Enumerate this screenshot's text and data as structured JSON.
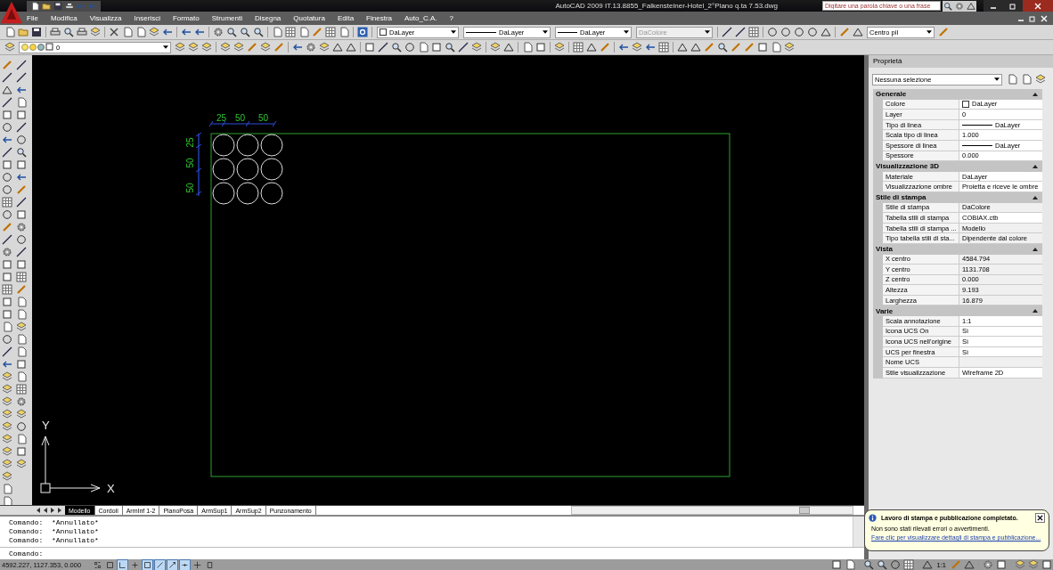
{
  "window": {
    "title": "AutoCAD 2009 IT.13.8855_Falkensteiner-Hotel_2°Piano q.ta 7.53.dwg"
  },
  "search": {
    "placeholder": "Digitare una parola chiave o una frase"
  },
  "menu": [
    "File",
    "Modifica",
    "Visualizza",
    "Inserisci",
    "Formato",
    "Strumenti",
    "Disegna",
    "Quotatura",
    "Edita",
    "Finestra",
    "Auto_C.A.",
    "?"
  ],
  "toolbar": {
    "object_color": "DaLayer",
    "linetype": "DaLayer",
    "lineweight": "DaLayer",
    "plot_style": {
      "value": "DaColore",
      "disabled": true
    },
    "dim_style": "Centro pil",
    "layer": "0"
  },
  "drawing": {
    "dimensions_horizontal": [
      "25",
      "50",
      "50"
    ],
    "dimensions_vertical": [
      "25",
      "50",
      "50"
    ],
    "ucs": {
      "x": "X",
      "y": "Y"
    }
  },
  "layout_tabs": [
    {
      "label": "Modello",
      "selected": true
    },
    {
      "label": "Cordoli",
      "selected": false
    },
    {
      "label": "ArmInf 1-2",
      "selected": false
    },
    {
      "label": "PianoPosa",
      "selected": false
    },
    {
      "label": "ArmSup1",
      "selected": false
    },
    {
      "label": "ArmSup2",
      "selected": false
    },
    {
      "label": "Punzonamento",
      "selected": false
    }
  ],
  "properties": {
    "title": "Proprietà",
    "selection": "Nessuna selezione",
    "sections": [
      {
        "title": "Generale",
        "expanded": true,
        "rows": [
          {
            "label": "Colore",
            "value": "DaLayer",
            "kind": "color",
            "readonly": false
          },
          {
            "label": "Layer",
            "value": "0",
            "kind": "text",
            "readonly": false
          },
          {
            "label": "Tipo di linea",
            "value": "DaLayer",
            "kind": "linetype",
            "readonly": false
          },
          {
            "label": "Scala tipo di linea",
            "value": "1.000",
            "kind": "text",
            "readonly": false
          },
          {
            "label": "Spessore di linea",
            "value": "DaLayer",
            "kind": "linetype",
            "readonly": false
          },
          {
            "label": "Spessore",
            "value": "0.000",
            "kind": "text",
            "readonly": false
          }
        ]
      },
      {
        "title": "Visualizzazione 3D",
        "expanded": true,
        "rows": [
          {
            "label": "Materiale",
            "value": "DaLayer",
            "kind": "text",
            "readonly": false
          },
          {
            "label": "Visualizzazione ombre",
            "value": "Proietta e riceve le ombre",
            "kind": "text",
            "readonly": false
          }
        ]
      },
      {
        "title": "Stile di stampa",
        "expanded": true,
        "rows": [
          {
            "label": "Stile di stampa",
            "value": "DaColore",
            "kind": "text",
            "readonly": true
          },
          {
            "label": "Tabella stili di stampa",
            "value": "COBIAX.ctb",
            "kind": "text",
            "readonly": false
          },
          {
            "label": "Tabella stili di stampa ...",
            "value": "Modello",
            "kind": "text",
            "readonly": true
          },
          {
            "label": "Tipo tabella stili di sta...",
            "value": "Dipendente dal colore",
            "kind": "text",
            "readonly": true
          }
        ]
      },
      {
        "title": "Vista",
        "expanded": true,
        "rows": [
          {
            "label": "X centro",
            "value": "4584.794",
            "kind": "text",
            "readonly": true
          },
          {
            "label": "Y centro",
            "value": "1131.708",
            "kind": "text",
            "readonly": true
          },
          {
            "label": "Z centro",
            "value": "0.000",
            "kind": "text",
            "readonly": true
          },
          {
            "label": "Altezza",
            "value": "9.193",
            "kind": "text",
            "readonly": true
          },
          {
            "label": "Larghezza",
            "value": "16.879",
            "kind": "text",
            "readonly": true
          }
        ]
      },
      {
        "title": "Varie",
        "expanded": true,
        "rows": [
          {
            "label": "Scala annotazione",
            "value": "1:1",
            "kind": "text",
            "readonly": false
          },
          {
            "label": "Icona UCS On",
            "value": "Sì",
            "kind": "text",
            "readonly": false
          },
          {
            "label": "Icona UCS nell'origine",
            "value": "Sì",
            "kind": "text",
            "readonly": false
          },
          {
            "label": "UCS per finestra",
            "value": "Sì",
            "kind": "text",
            "readonly": false
          },
          {
            "label": "Nome UCS",
            "kind": "text",
            "readonly": true
          },
          {
            "label": "Stile visualizzazione",
            "value": "Wireframe 2D",
            "kind": "text",
            "readonly": false
          }
        ]
      }
    ]
  },
  "command": {
    "history": [
      "Comando:  *Annullato*",
      "Comando:  *Annullato*",
      "Comando:  *Annullato*"
    ],
    "prompt": "Comando:"
  },
  "status_bar": {
    "coordinates": "4592.227, 1127.353, 0.000",
    "toggles": [
      {
        "on": false
      },
      {
        "on": false
      },
      {
        "on": true
      },
      {
        "on": false
      },
      {
        "on": true
      },
      {
        "on": true
      },
      {
        "on": true
      },
      {
        "on": true
      },
      {
        "on": false
      },
      {
        "on": false
      }
    ],
    "annotation_scale": "1:1"
  },
  "notification": {
    "title": "Lavoro di stampa e pubblicazione completato.",
    "message": "Non sono stati rilevati errori o avvertimenti.",
    "link": "Fare clic per visualizzare dettagli di stampa e pubblicazione..."
  }
}
